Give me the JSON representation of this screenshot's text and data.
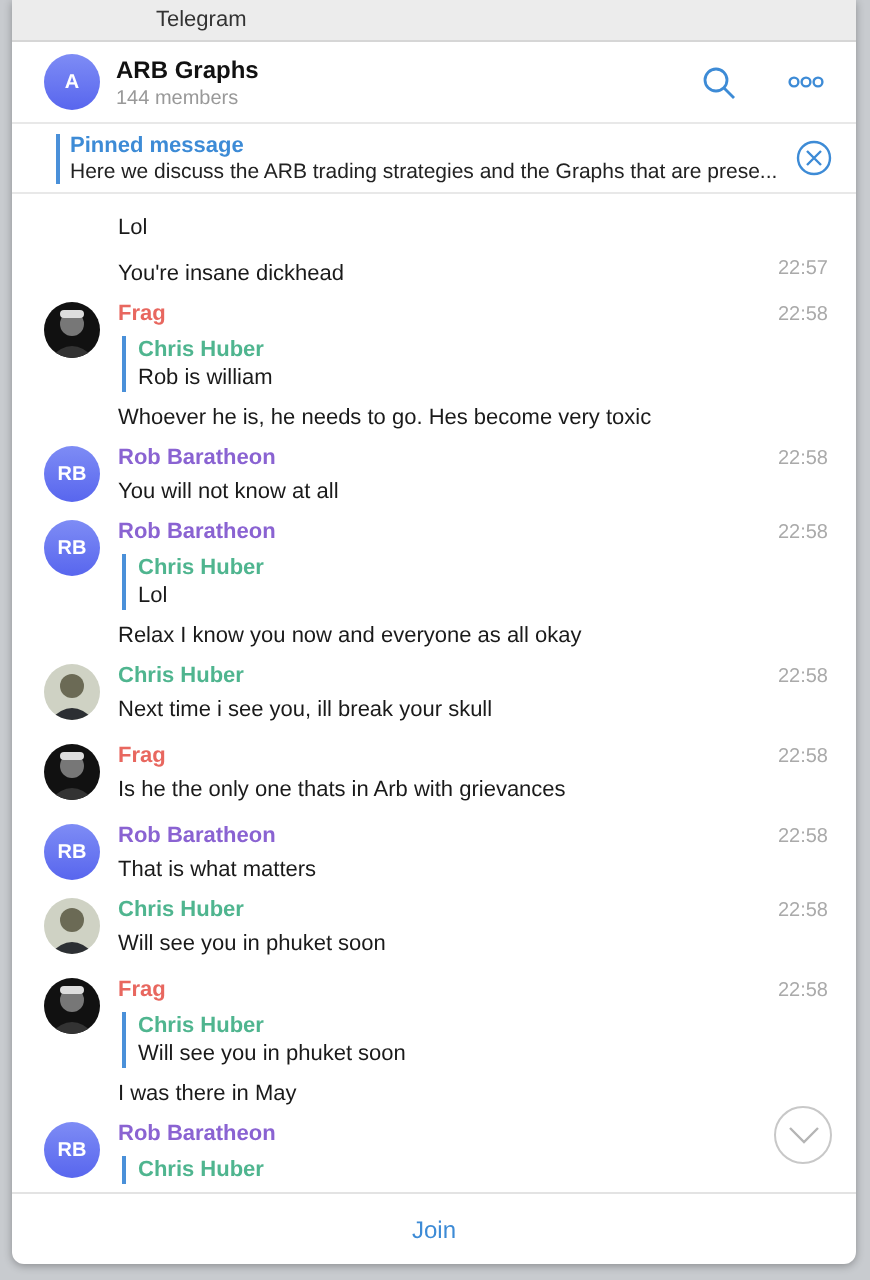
{
  "window": {
    "title": "Telegram"
  },
  "chat": {
    "avatar_text": "A",
    "title": "ARB Graphs",
    "subtitle": "144 members"
  },
  "pinned": {
    "label": "Pinned message",
    "text": "Here we discuss the ARB trading strategies and the Graphs that are prese..."
  },
  "messages": [
    {
      "kind": "continuation",
      "text": "Lol"
    },
    {
      "kind": "continuation",
      "text": "You're insane dickhead",
      "time": "22:57"
    },
    {
      "kind": "message",
      "sender": "Frag",
      "color": "#e8675f",
      "avatar": {
        "kind": "photo-dark"
      },
      "time": "22:58",
      "reply": {
        "name": "Chris Huber",
        "color": "#4fb58f",
        "text": "Rob is william"
      },
      "text": "Whoever he is, he needs to go. Hes become very toxic"
    },
    {
      "kind": "message",
      "sender": "Rob Baratheon",
      "color": "#8a63d2",
      "avatar": {
        "kind": "initials",
        "text": "RB"
      },
      "time": "22:58",
      "text": "You will not know at all"
    },
    {
      "kind": "message",
      "sender": "Rob Baratheon",
      "color": "#8a63d2",
      "avatar": {
        "kind": "initials",
        "text": "RB"
      },
      "time": "22:58",
      "reply": {
        "name": "Chris Huber",
        "color": "#4fb58f",
        "text": "Lol"
      },
      "text": "Relax I know you now and everyone as all okay"
    },
    {
      "kind": "message",
      "sender": "Chris Huber",
      "color": "#4fb58f",
      "avatar": {
        "kind": "photo-light"
      },
      "time": "22:58",
      "text": "Next time i see you, ill break your skull"
    },
    {
      "kind": "message",
      "sender": "Frag",
      "color": "#e8675f",
      "avatar": {
        "kind": "photo-dark"
      },
      "time": "22:58",
      "text": "Is he the only one thats in Arb with grievances"
    },
    {
      "kind": "message",
      "sender": "Rob Baratheon",
      "color": "#8a63d2",
      "avatar": {
        "kind": "initials",
        "text": "RB"
      },
      "time": "22:58",
      "text": "That is what matters"
    },
    {
      "kind": "message",
      "sender": "Chris Huber",
      "color": "#4fb58f",
      "avatar": {
        "kind": "photo-light"
      },
      "time": "22:58",
      "text": "Will see you in phuket soon"
    },
    {
      "kind": "message",
      "sender": "Frag",
      "color": "#e8675f",
      "avatar": {
        "kind": "photo-dark"
      },
      "time": "22:58",
      "reply": {
        "name": "Chris Huber",
        "color": "#4fb58f",
        "text": "Will see you in phuket soon"
      },
      "text": "I was there in May"
    },
    {
      "kind": "message",
      "sender": "Rob Baratheon",
      "color": "#8a63d2",
      "avatar": {
        "kind": "initials",
        "text": "RB"
      },
      "reply": {
        "name": "Chris Huber",
        "color": "#4fb58f"
      }
    }
  ],
  "join_button": "Join"
}
